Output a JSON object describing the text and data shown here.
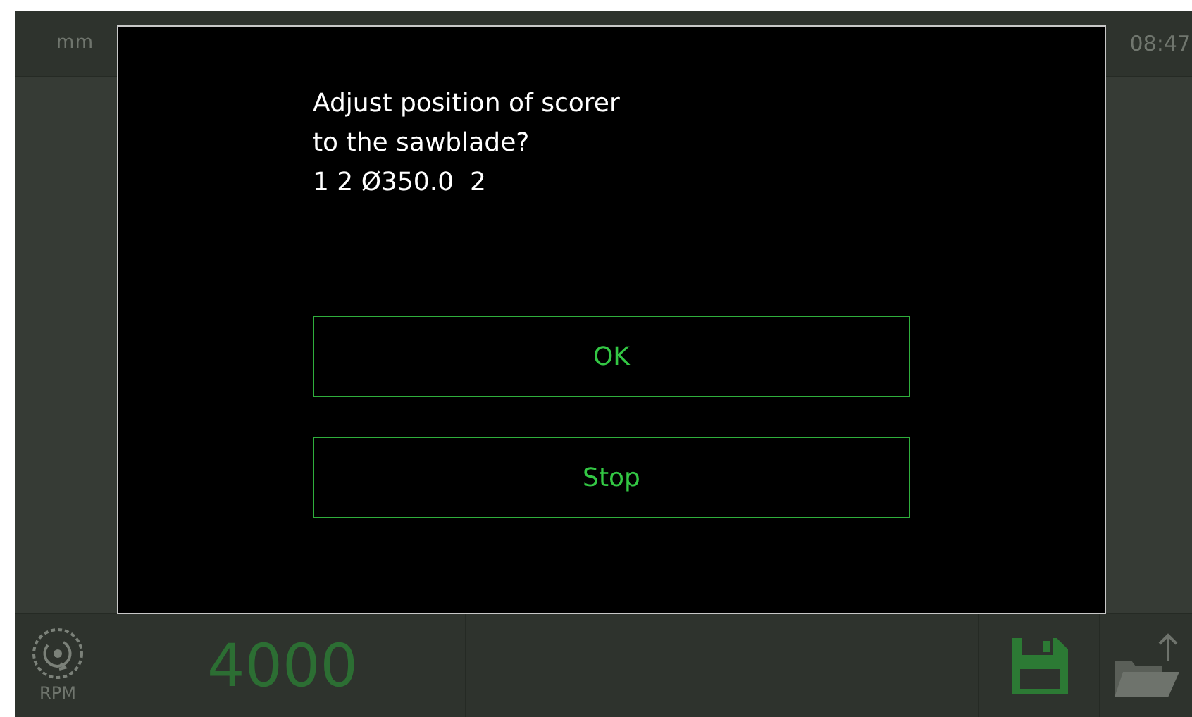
{
  "status_bar": {
    "unit": "mm",
    "time": "08:47"
  },
  "dialog": {
    "message_lines": [
      "Adjust position of scorer",
      "to the sawblade?",
      "1 2 Ø350.0  2"
    ],
    "buttons": [
      "OK",
      "Stop"
    ]
  },
  "bottom_bar": {
    "speed_label": "RPM",
    "speed_value": "4000"
  }
}
